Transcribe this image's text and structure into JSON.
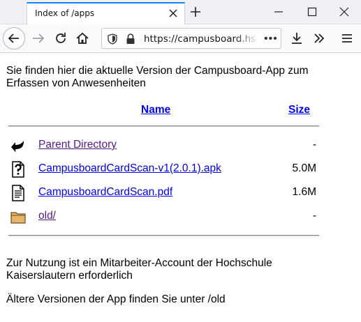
{
  "browser": {
    "tab_title": "Index of /apps",
    "url": "https://campusboard.hs-kl.de/apps/"
  },
  "page": {
    "intro": "Sie finden hier die aktuelle Version der Campusboard-App zum Erfassen von Anwesenheiten",
    "columns": {
      "name": "Name",
      "size": "Size"
    },
    "rows": [
      {
        "name": "Parent Directory",
        "size": "-",
        "icon": "back-arrow-icon"
      },
      {
        "name": "CampusboardCardScan-v1(2.0.1).apk",
        "size": "5.0M",
        "icon": "unknown-file-icon"
      },
      {
        "name": "CampusboardCardScan.pdf",
        "size": "1.6M",
        "icon": "text-file-icon"
      },
      {
        "name": "old/",
        "size": "-",
        "icon": "folder-icon"
      }
    ],
    "note1": "Zur Nutzung ist ein Mitarbeiter-Account der Hochschule Kaiserslautern erforderlich",
    "note2": "Ältere Versionen der App finden Sie unter /old"
  },
  "colors": {
    "link": "#0000ee",
    "visited": "#551a8b",
    "tab_accent": "#0a84ff"
  }
}
